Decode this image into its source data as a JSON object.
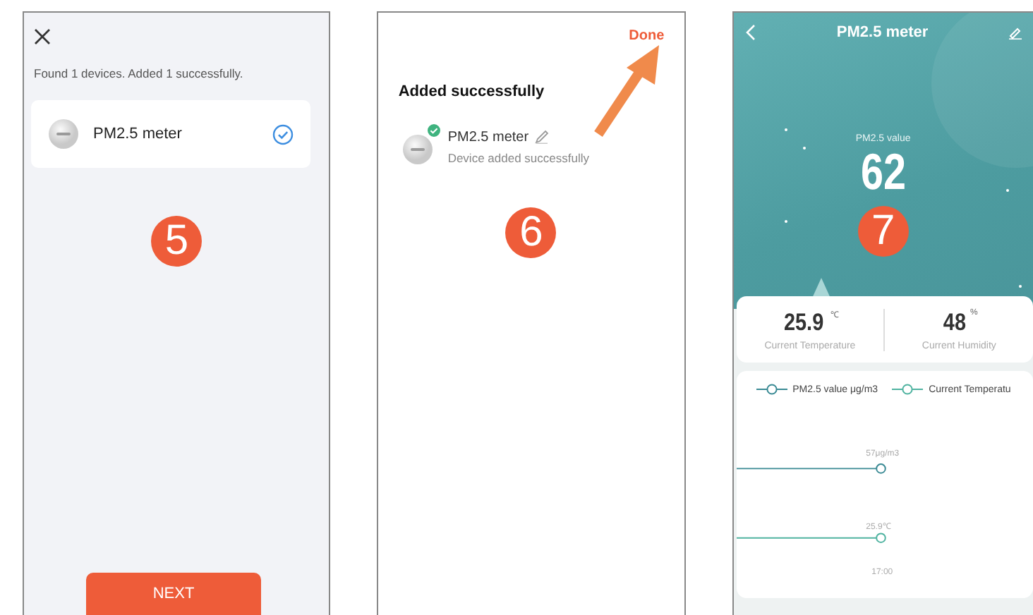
{
  "screens": [
    {
      "kind": "found",
      "message": "Found 1 devices. Added 1 successfully.",
      "devices": [
        {
          "name": "PM2.5 meter",
          "selected": true
        }
      ],
      "step": "5",
      "button": "NEXT"
    },
    {
      "kind": "added",
      "action": "Done",
      "heading": "Added successfully",
      "devices": [
        {
          "name": "PM2.5 meter",
          "status": "Device added successfully"
        }
      ],
      "step": "6"
    },
    {
      "kind": "detail",
      "title": "PM2.5 meter",
      "value_label": "PM2.5 value",
      "value": "62",
      "step": "7",
      "stats": [
        {
          "value": "25.9",
          "unit": "℃",
          "label": "Current Temperature"
        },
        {
          "value": "48",
          "unit": "%",
          "label": "Current Humidity"
        }
      ],
      "chart": {
        "legend": [
          {
            "name": "PM2.5 value μg/m3",
            "color": "#3a8a94"
          },
          {
            "name": "Current Temperatu",
            "color": "#4fb3a0"
          }
        ],
        "points": [
          {
            "label": "57μg/m3"
          },
          {
            "label": "25.9℃"
          }
        ],
        "time": "17:00"
      }
    }
  ]
}
